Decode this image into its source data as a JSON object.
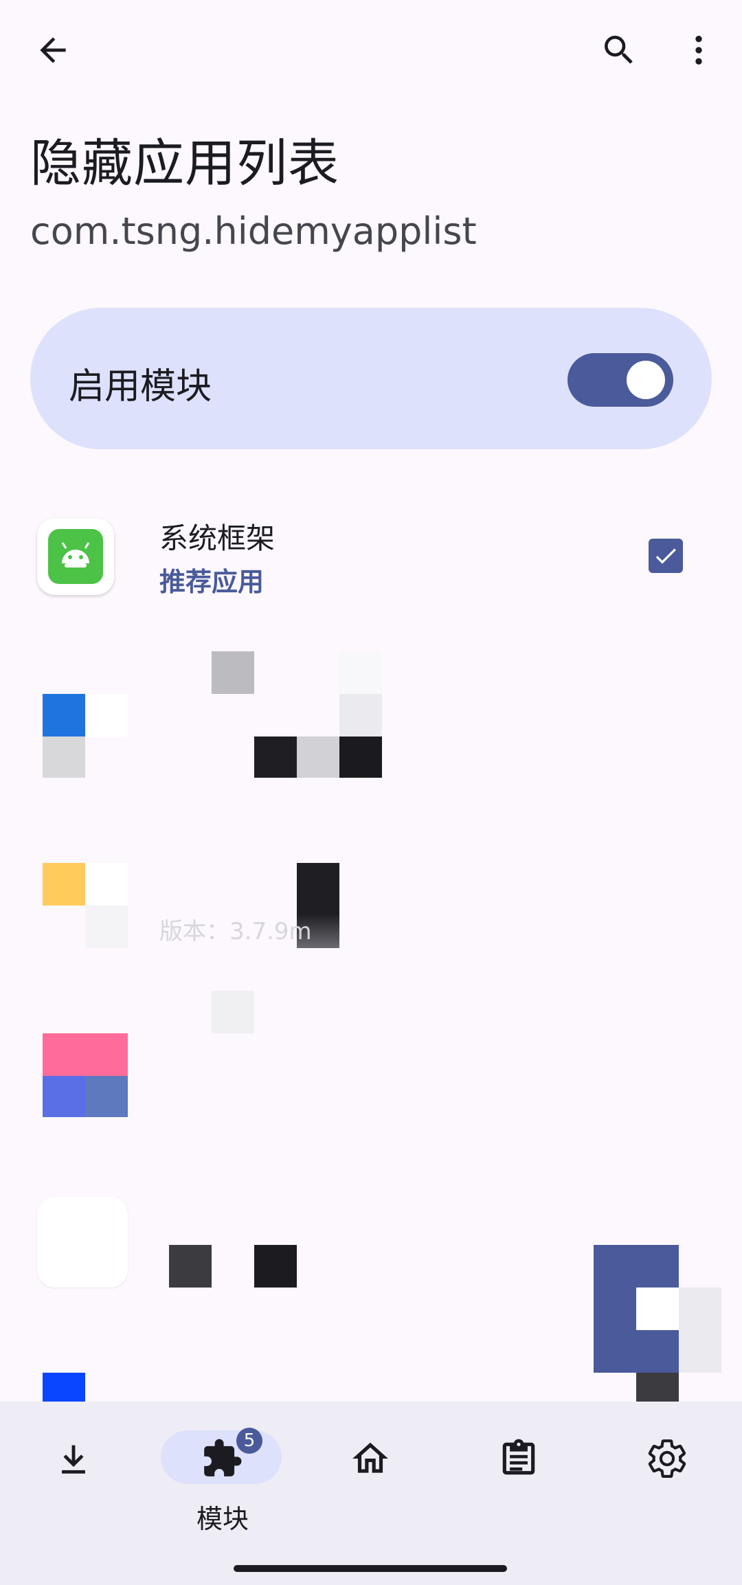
{
  "header": {
    "back_icon": "arrow-back-icon",
    "search_icon": "search-icon",
    "more_icon": "more-vert-icon",
    "title": "隐藏应用列表",
    "package": "com.tsng.hidemyapplist"
  },
  "enable": {
    "label": "启用模块",
    "enabled": true
  },
  "apps": [
    {
      "name": "系统框架",
      "subtitle": "推荐应用",
      "checked": true
    }
  ],
  "partial_text": {
    "version_fragment": "版本：3.7.9m"
  },
  "nav": {
    "items": [
      {
        "icon": "download-icon",
        "label": ""
      },
      {
        "icon": "puzzle-icon",
        "label": "模块",
        "badge": "5",
        "selected": true
      },
      {
        "icon": "home-icon",
        "label": ""
      },
      {
        "icon": "clipboard-icon",
        "label": ""
      },
      {
        "icon": "gear-icon",
        "label": ""
      }
    ]
  },
  "colors": {
    "background": "#fcf8fd",
    "accent": "#4a5a9a",
    "card": "#dde1fb",
    "nav_bg": "#eeecf4",
    "android_green": "#4cc247"
  }
}
